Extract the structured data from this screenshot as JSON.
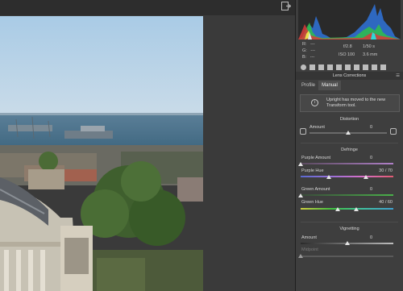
{
  "info": {
    "r_label": "R:",
    "r_value": "---",
    "g_label": "G:",
    "g_value": "---",
    "b_label": "B:",
    "b_value": "---",
    "aperture": "f/2.8",
    "shutter": "1/50 s",
    "iso": "ISO 100",
    "focal": "3.6 mm"
  },
  "panel": {
    "section_title": "Lens Corrections",
    "menu_icon": "menu-icon",
    "tabs": [
      "Profile",
      "Manual"
    ],
    "notice": "Upright has moved to the new Transform tool."
  },
  "distortion": {
    "heading": "Distortion",
    "amount_label": "Amount",
    "amount_value": "0",
    "amount_level": 0.5
  },
  "defringe": {
    "heading": "Defringe",
    "purple_amount_label": "Purple Amount",
    "purple_amount_value": "0",
    "purple_amount_level": 0.0,
    "purple_hue_label": "Purple Hue",
    "purple_hue_value": "30 / 70",
    "purple_hue_low": 0.3,
    "purple_hue_high": 0.7,
    "green_amount_label": "Green Amount",
    "green_amount_value": "0",
    "green_amount_level": 0.0,
    "green_hue_label": "Green Hue",
    "green_hue_value": "40 / 60",
    "green_hue_low": 0.4,
    "green_hue_high": 0.6
  },
  "vignetting": {
    "heading": "Vignetting",
    "amount_label": "Amount",
    "amount_value": "0",
    "amount_level": 0.5,
    "midpoint_label": "Midpoint",
    "midpoint_level": 0.0
  },
  "colors": {
    "accent": "#5b8fd6",
    "panel_bg": "#3e3e3e",
    "canvas_bg": "#3a3a3a"
  }
}
